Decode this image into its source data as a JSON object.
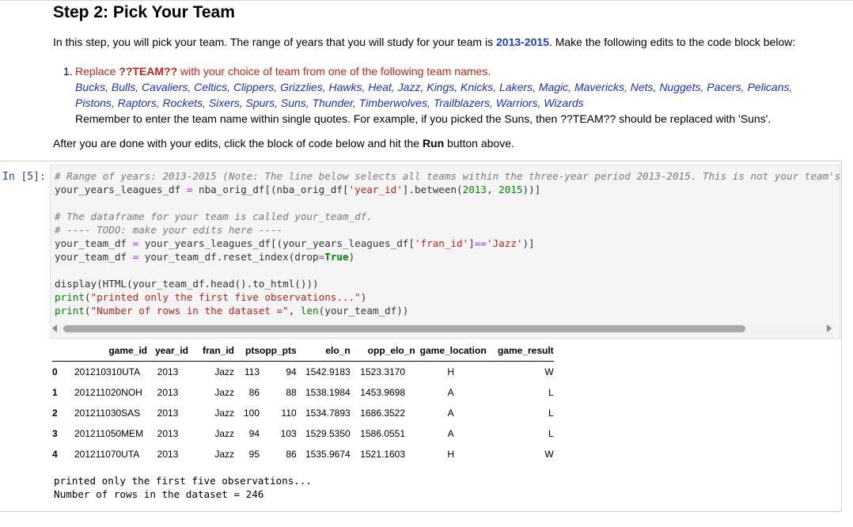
{
  "markdown": {
    "title": "Step 2: Pick Your Team",
    "intro_before": "In this step, you will pick your team. The range of years that you will study for your team is ",
    "intro_years": "2013-2015",
    "intro_after": ". Make the following edits to the code block below:",
    "instruction": {
      "number": "1.",
      "replace_text": "Replace ",
      "placeholder": "??TEAM??",
      "replace_rest": " with your choice of team from one of the following team names.",
      "teams_line1": "Bucks, Bulls, Cavaliers, Celtics, Clippers, Grizzlies, Hawks, Heat, Jazz, Kings, Knicks, Lakers, Magic, Mavericks, Nets, Nuggets, Pacers, Pelicans,",
      "teams_line2": "Pistons, Raptors, Rockets, Sixers, Spurs, Suns, Thunder, Timberwolves, Trailblazers, Warriors, Wizards",
      "reminder": "Remember to enter the team name within single quotes. For example, if you picked the Suns, then ??TEAM?? should be replaced with 'Suns'."
    },
    "after_before": "After you are done with your edits, click the block of code below and hit the ",
    "after_run": "Run",
    "after_after": " button above.",
    "colors": {
      "highlight_blue": "#1f3fc4",
      "instruction_red": "#c0241c",
      "teams_blue": "#1a2fcf"
    }
  },
  "cell": {
    "prompt": "In [5]:",
    "code": {
      "l1": "# Range of years: 2013-2015 (Note: The line below selects all teams within the three-year period 2013-2015. This is not your team's",
      "l2a": "your_years_leagues_df ",
      "l2op": "=",
      "l2b": " nba_orig_df[(nba_orig_df[",
      "l2s": "'year_id'",
      "l2c": "].between(",
      "l2n1": "2013",
      "l2d": ", ",
      "l2n2": "2015",
      "l2e": "))]",
      "l4": "# The dataframe for your team is called your_team_df.",
      "l5": "# ---- TODO: make your edits here ----",
      "l6a": "your_team_df ",
      "l6op": "=",
      "l6b": " your_years_leagues_df[(your_years_leagues_df[",
      "l6s": "'fran_id'",
      "l6c": "]",
      "l6op2": "==",
      "l6s2": "'Jazz'",
      "l6d": ")]",
      "l7a": "your_team_df ",
      "l7op": "=",
      "l7b": " your_team_df.reset_index(drop",
      "l7op2": "=",
      "l7kw": "True",
      "l7c": ")",
      "l9": "display(HTML(your_team_df.head().to_html()))",
      "l10a": "print",
      "l10b": "(",
      "l10s": "\"printed only the first five observations...\"",
      "l10c": ")",
      "l11a": "print",
      "l11b": "(",
      "l11s": "\"Number of rows in the dataset =\"",
      "l11c": ", ",
      "l11d": "len",
      "l11e": "(your_team_df))"
    },
    "table": {
      "columns": [
        "",
        "game_id",
        "year_id",
        "fran_id",
        "pts",
        "opp_pts",
        "elo_n",
        "opp_elo_n",
        "game_location",
        "game_result"
      ],
      "rows": [
        [
          "0",
          "201210310UTA",
          "2013",
          "Jazz",
          "113",
          "94",
          "1542.9183",
          "1523.3170",
          "H",
          "W"
        ],
        [
          "1",
          "201211020NOH",
          "2013",
          "Jazz",
          "86",
          "88",
          "1538.1984",
          "1453.9698",
          "A",
          "L"
        ],
        [
          "2",
          "201211030SAS",
          "2013",
          "Jazz",
          "100",
          "110",
          "1534.7893",
          "1686.3522",
          "A",
          "L"
        ],
        [
          "3",
          "201211050MEM",
          "2013",
          "Jazz",
          "94",
          "103",
          "1529.5350",
          "1586.0551",
          "A",
          "L"
        ],
        [
          "4",
          "201211070UTA",
          "2013",
          "Jazz",
          "95",
          "86",
          "1535.9674",
          "1521.1603",
          "H",
          "W"
        ]
      ]
    },
    "output_lines": [
      "printed only the first five observations...",
      "Number of rows in the dataset = 246"
    ],
    "icons": {
      "scroll_left": "scroll-left-arrow-icon",
      "scroll_right": "scroll-right-arrow-icon"
    }
  }
}
